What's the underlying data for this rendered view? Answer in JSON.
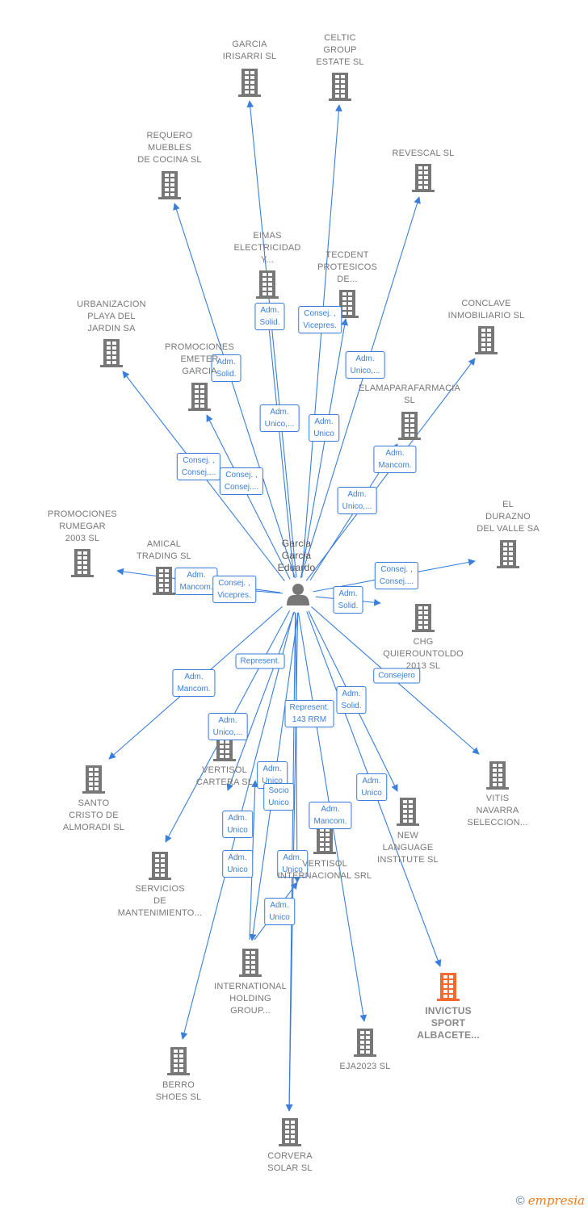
{
  "colors": {
    "edge": "#3a7fdc",
    "node": "#777777",
    "highlight": "#f26a30",
    "person": "#777777"
  },
  "center": {
    "id": "eduardo",
    "icon": "person-icon",
    "label": [
      "Garcia",
      "Garcia",
      "Eduardo"
    ]
  },
  "nodes": [
    {
      "id": "irisarri",
      "label": [
        "GARCIA",
        "IRISARRI  SL"
      ]
    },
    {
      "id": "celtic",
      "label": [
        "CELTIC",
        "GROUP",
        "ESTATE  SL"
      ]
    },
    {
      "id": "requero",
      "label": [
        "REQUERO",
        "MUEBLES",
        "DE COCINA  SL"
      ]
    },
    {
      "id": "revescal",
      "label": [
        "REVESCAL SL"
      ]
    },
    {
      "id": "eimas",
      "label": [
        "EIMAS",
        "ELECTRICIDAD",
        "Y..."
      ]
    },
    {
      "id": "tecdent",
      "label": [
        "TECDENT",
        "PROTESICOS",
        "DE..."
      ]
    },
    {
      "id": "urbanizacion",
      "label": [
        "URBANIZACION",
        "PLAYA DEL",
        "JARDIN SA"
      ]
    },
    {
      "id": "conclave",
      "label": [
        "CONCLAVE",
        "INMOBILIARIO SL"
      ]
    },
    {
      "id": "emeter",
      "label": [
        "PROMOCIONES",
        "EMETER",
        "GARCIA"
      ]
    },
    {
      "id": "elama",
      "label": [
        "ELAMAPARAFARMACIA",
        "SL"
      ]
    },
    {
      "id": "durazno",
      "label": [
        "EL",
        "DURAZNO",
        "DEL VALLE SA"
      ]
    },
    {
      "id": "rumegar",
      "label": [
        "PROMOCIONES",
        "RUMEGAR",
        "2003  SL"
      ]
    },
    {
      "id": "amical",
      "label": [
        "AMICAL",
        "TRADING  SL"
      ]
    },
    {
      "id": "chg",
      "label": [
        "CHG",
        "QUIEROUNTOLDO",
        "2013  SL"
      ]
    },
    {
      "id": "santo",
      "label": [
        "SANTO",
        "CRISTO DE",
        "ALMORADI  SL"
      ]
    },
    {
      "id": "vcartera",
      "label": [
        "VERTISOL",
        "CARTERA  SL"
      ]
    },
    {
      "id": "vitis",
      "label": [
        "VITIS",
        "NAVARRA",
        "SELECCION..."
      ]
    },
    {
      "id": "newlang",
      "label": [
        "NEW",
        "LANGUAGE",
        "INSTITUTE  SL"
      ]
    },
    {
      "id": "vinter",
      "label": [
        "VERTISOL",
        "INTERNACIONAL SRL"
      ]
    },
    {
      "id": "servicios",
      "label": [
        "SERVICIOS",
        "DE",
        "MANTENIMIENTO..."
      ]
    },
    {
      "id": "intl",
      "label": [
        "INTERNATIONAL",
        "HOLDING",
        "GROUP..."
      ]
    },
    {
      "id": "invictus",
      "label": [
        "INVICTUS",
        "SPORT",
        "ALBACETE..."
      ],
      "highlight": true
    },
    {
      "id": "eja",
      "label": [
        "EJA2023  SL"
      ]
    },
    {
      "id": "berro",
      "label": [
        "BERRO",
        "SHOES SL"
      ]
    },
    {
      "id": "corvera",
      "label": [
        "CORVERA",
        "SOLAR SL"
      ]
    }
  ],
  "edges": [
    {
      "to": "eimas",
      "label": [
        "Adm.",
        "Solid."
      ]
    },
    {
      "to": "tecdent",
      "label": [
        "Consej. ,",
        "Vicepres."
      ]
    },
    {
      "to": "requero",
      "label": [
        "Adm.",
        "Solid."
      ]
    },
    {
      "to": "revescal",
      "label": [
        "Adm.",
        "Unico,..."
      ]
    },
    {
      "to": "irisarri",
      "label": [
        "Adm.",
        "Unico,..."
      ]
    },
    {
      "to": "celtic",
      "label": [
        "Adm.",
        "Unico"
      ]
    },
    {
      "to": "urbanizacion",
      "label": [
        "Consej. ,",
        "Consej...."
      ]
    },
    {
      "to": "emeter",
      "label": [
        "Consej. ,",
        "Consej...."
      ]
    },
    {
      "to": "elama",
      "label": [
        "Adm.",
        "Mancom."
      ]
    },
    {
      "to": "conclave",
      "label": [
        "Adm.",
        "Unico,..."
      ]
    },
    {
      "to": "rumegar",
      "label": [
        "Adm.",
        "Mancom."
      ]
    },
    {
      "to": "amical",
      "label": [
        "Consej. ,",
        "Vicepres."
      ]
    },
    {
      "to": "durazno",
      "label": [
        "Consej. ,",
        "Consej...."
      ]
    },
    {
      "to": "chg",
      "label": [
        "Adm.",
        "Solid."
      ]
    },
    {
      "to": "intl",
      "label": [
        "Represent."
      ]
    },
    {
      "to": "santo",
      "label": [
        "Adm.",
        "Mancom."
      ]
    },
    {
      "to": "vitis",
      "label": [
        "Consejero"
      ]
    },
    {
      "to": "newlang",
      "label": [
        "Adm.",
        "Solid."
      ]
    },
    {
      "to": "eja",
      "label": [
        "Represent.",
        "143 RRM"
      ]
    },
    {
      "to": "servicios",
      "label": [
        "Adm.",
        "Unico,..."
      ]
    },
    {
      "to": "vcartera",
      "label": [
        "Adm.",
        "Unico"
      ]
    },
    {
      "to": "vinter",
      "label": [
        "Socio",
        "Unico"
      ]
    },
    {
      "to": "corvera",
      "label": [
        "Adm.",
        "Mancom."
      ]
    },
    {
      "to": "invictus",
      "label": [
        "Adm.",
        "Unico"
      ]
    },
    {
      "to": "vcartera",
      "label": [
        "Adm.",
        "Unico"
      ],
      "from": "intl"
    },
    {
      "to": "berro",
      "label": [
        "Adm.",
        "Unico"
      ]
    },
    {
      "to": "vinter",
      "label": [
        "Adm.",
        "Unico"
      ],
      "from": "intl"
    },
    {
      "to": "corvera",
      "label": [
        "Adm.",
        "Unico"
      ]
    }
  ],
  "footer": {
    "copyright_symbol": "©",
    "brand": "empresia"
  }
}
